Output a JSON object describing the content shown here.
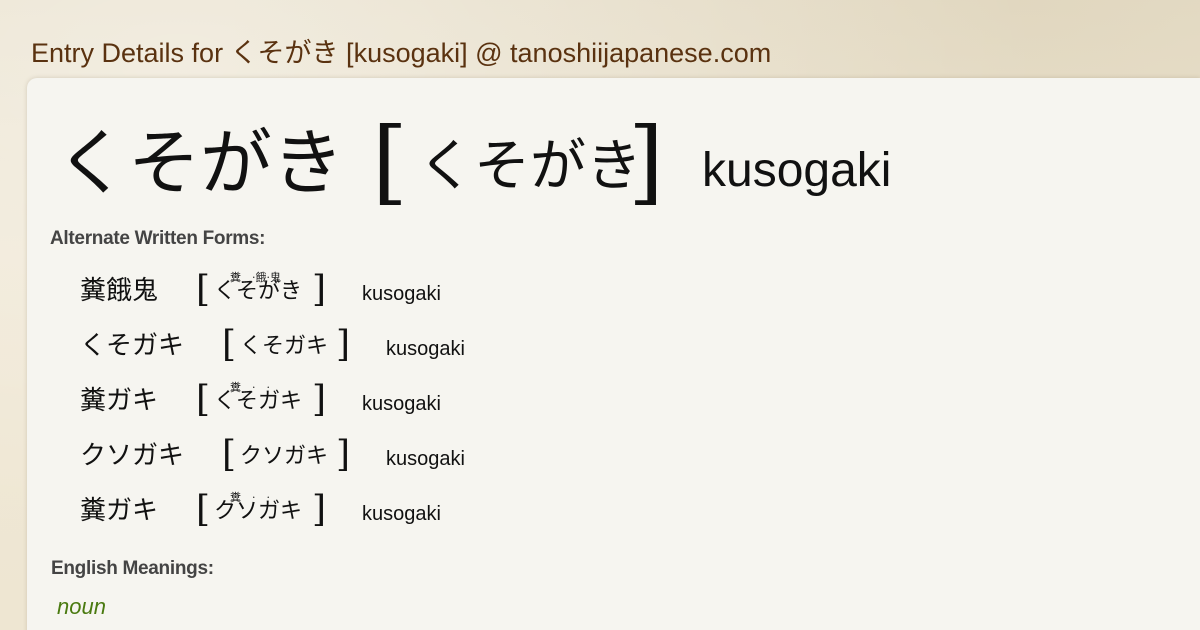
{
  "page": {
    "title": "Entry Details for くそがき [kusogaki] @ tanoshiijapanese.com"
  },
  "entry": {
    "headword": "くそがき",
    "reading": "くそがき",
    "bracket_open": "[",
    "bracket_close": "]",
    "romaji": "kusogaki"
  },
  "alternate_forms": {
    "label": "Alternate Written Forms:",
    "items": [
      {
        "text": "糞餓鬼",
        "reading": "くそがき",
        "furigana": "糞　·餓·鬼",
        "romaji": "kusogaki"
      },
      {
        "text": "くそガキ",
        "reading": "くそガキ",
        "furigana": "",
        "romaji": "kusogaki"
      },
      {
        "text": "糞ガキ",
        "reading": "くそガキ",
        "furigana": "糞　·　·",
        "romaji": "kusogaki"
      },
      {
        "text": "クソガキ",
        "reading": "クソガキ",
        "furigana": "",
        "romaji": "kusogaki"
      },
      {
        "text": "糞ガキ",
        "reading": "クソガキ",
        "furigana": "糞　·　·",
        "romaji": "kusogaki"
      }
    ]
  },
  "meanings": {
    "label": "English Meanings:",
    "part_of_speech": "noun"
  },
  "colors": {
    "title": "#5a3210",
    "card": "#f6f5f0",
    "pos": "#4a7a10"
  }
}
